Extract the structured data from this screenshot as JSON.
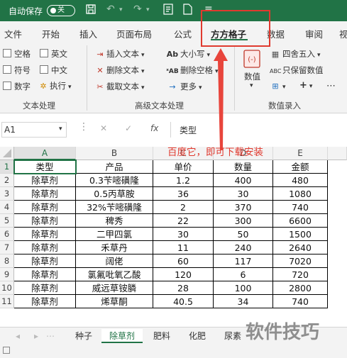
{
  "titlebar": {
    "autosave_label": "自动保存",
    "autosave_state": "关",
    "icons": [
      "save-icon",
      "undo-icon",
      "redo-icon",
      "format-icon",
      "new-file-icon",
      "more-icon"
    ]
  },
  "tabs": [
    {
      "label": "文件"
    },
    {
      "label": "开始"
    },
    {
      "label": "插入"
    },
    {
      "label": "页面布局"
    },
    {
      "label": "公式"
    },
    {
      "label": "方方格子",
      "active": true
    },
    {
      "label": "数据"
    },
    {
      "label": "审阅"
    },
    {
      "label": "视"
    }
  ],
  "ribbon": {
    "text_processing": {
      "checkboxes": [
        "空格",
        "英文",
        "符号",
        "中文",
        "数字"
      ],
      "execute_label": "执行",
      "group_label": "文本处理"
    },
    "advanced_text": {
      "insert_text": "插入文本",
      "delete_text": "删除文本",
      "extract_text": "截取文本",
      "case": "大小写",
      "delete_space": "删除空格",
      "more": "更多",
      "group_label": "高级文本处理"
    },
    "number_entry": {
      "value_label": "数值",
      "round": "四舍五入",
      "keep_value": "只保留数值",
      "group_label": "数值录入"
    }
  },
  "formula_bar": {
    "name_box": "A1",
    "fx_label": "fx",
    "content": "类型"
  },
  "grid": {
    "columns": [
      "A",
      "B",
      "C",
      "D",
      "E"
    ],
    "selected_column": "A",
    "row_numbers": [
      "1",
      "2",
      "3",
      "4",
      "5",
      "6",
      "7",
      "8",
      "9",
      "10",
      "11"
    ],
    "rows": [
      [
        "类型",
        "产品",
        "单价",
        "数量",
        "金额"
      ],
      [
        "除草剂",
        "0.3苄嘧磺隆",
        "1.2",
        "400",
        "480"
      ],
      [
        "除草剂",
        "0.5丙草胺",
        "36",
        "30",
        "1080"
      ],
      [
        "除草剂",
        "32%苄嘧磺隆",
        "2",
        "370",
        "740"
      ],
      [
        "除草剂",
        "稗秀",
        "22",
        "300",
        "6600"
      ],
      [
        "除草剂",
        "二甲四氯",
        "30",
        "50",
        "1500"
      ],
      [
        "除草剂",
        "禾草丹",
        "11",
        "240",
        "2640"
      ],
      [
        "除草剂",
        "阔佬",
        "60",
        "117",
        "7020"
      ],
      [
        "除草剂",
        "氯氟吡氧乙酸",
        "120",
        "6",
        "720"
      ],
      [
        "除草剂",
        "威远草铵膦",
        "28",
        "100",
        "2800"
      ],
      [
        "除草剂",
        "烯草酮",
        "40.5",
        "34",
        "740"
      ]
    ]
  },
  "sheet_tabs": [
    {
      "label": "种子"
    },
    {
      "label": "除草剂",
      "active": true
    },
    {
      "label": "肥料"
    },
    {
      "label": "化肥"
    },
    {
      "label": "尿素"
    }
  ],
  "annotation": {
    "text": "百度它，即可下载安装",
    "color": "#e03a2f"
  },
  "watermark": "软件技巧",
  "colors": {
    "brand": "#217346",
    "annotation": "#e03a2f"
  }
}
